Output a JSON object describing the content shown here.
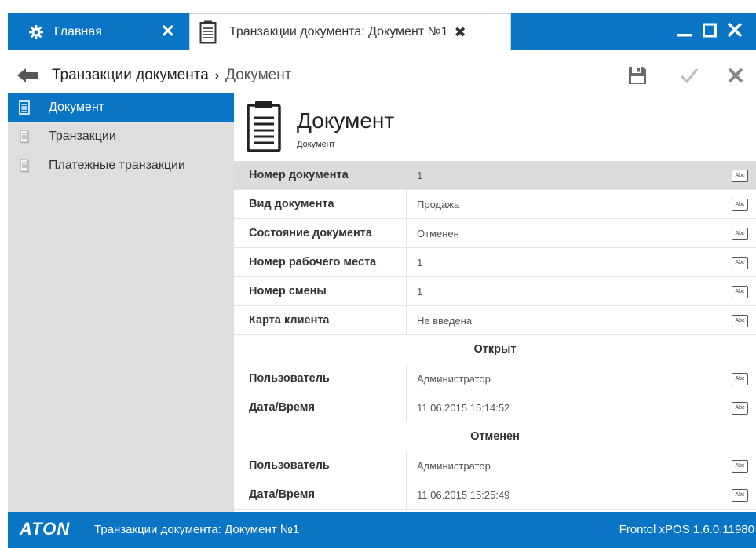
{
  "titlebar": {
    "home_tab": {
      "label": "Главная",
      "close": "✕"
    },
    "doc_tab": {
      "label": "Транзакции документа: Документ №1",
      "close": "✖"
    },
    "window_controls": [
      "minimize-icon",
      "maximize-icon",
      "close-icon"
    ]
  },
  "breadcrumb": {
    "root": "Транзакции документа",
    "separator": "›",
    "current": "Документ"
  },
  "toolbar": {
    "icons": [
      "save-icon",
      "check-icon",
      "close-icon"
    ]
  },
  "sidebar": {
    "items": [
      {
        "label": "Документ",
        "active": true
      },
      {
        "label": "Транзакции",
        "active": false
      },
      {
        "label": "Платежные транзакции",
        "active": false
      }
    ]
  },
  "main": {
    "title": "Документ",
    "subtitle": "Документ",
    "fields": [
      {
        "key": "Номер документа",
        "value": "1",
        "badge": "Abc"
      },
      {
        "key": "Вид документа",
        "value": "Продажа",
        "badge": "Abc"
      },
      {
        "key": "Состояние документа",
        "value": "Отменен",
        "badge": "Abc"
      },
      {
        "key": "Номер рабочего места",
        "value": "1",
        "badge": "Abc"
      },
      {
        "key": "Номер смены",
        "value": "1",
        "badge": "Abc"
      },
      {
        "key": "Карта клиента",
        "value": "Не введена",
        "badge": "Abc"
      }
    ],
    "opened": {
      "heading": "Открыт",
      "fields": [
        {
          "key": "Пользователь",
          "value": "Администратор",
          "badge": "Abc"
        },
        {
          "key": "Дата/Время",
          "value": "11.06.2015 15:14:52",
          "badge": "Abc"
        }
      ]
    },
    "cancelled": {
      "heading": "Отменен",
      "fields": [
        {
          "key": "Пользователь",
          "value": "Администратор",
          "badge": "Abc"
        },
        {
          "key": "Дата/Время",
          "value": "11.06.2015 15:25:49",
          "badge": "Abc"
        }
      ]
    }
  },
  "statusbar": {
    "logo": "ATON",
    "text": "Транзакции документа: Документ №1",
    "version": "Frontol xPOS 1.6.0.11980"
  },
  "colors": {
    "accent": "#0a75c5",
    "sidebar_bg": "#dedede",
    "selected_row": "#dcdcdc"
  }
}
